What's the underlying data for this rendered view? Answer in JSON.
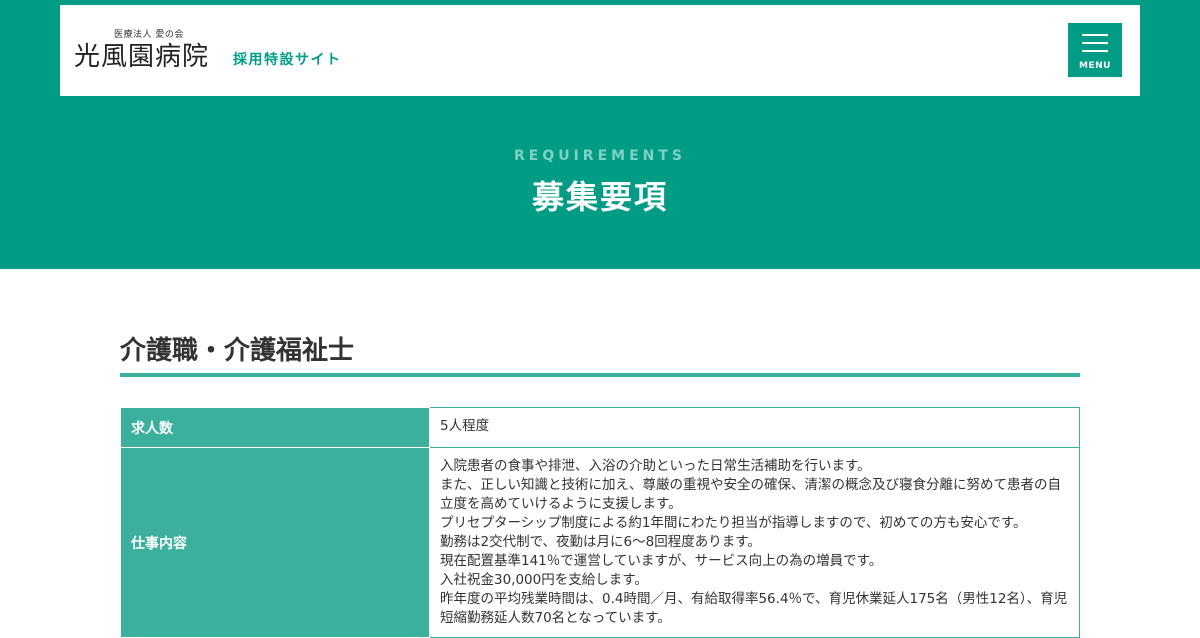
{
  "header": {
    "logo_sub": "医療法人 愛の会",
    "logo_main": "光風園病院",
    "logo_tag": "採用特設サイト",
    "menu_label": "MENU"
  },
  "hero": {
    "eyebrow": "REQUIREMENTS",
    "title": "募集要項"
  },
  "section": {
    "heading": "介護職・介護福祉士"
  },
  "table": {
    "rows": [
      {
        "label": "求人数",
        "lines": [
          "5人程度"
        ]
      },
      {
        "label": "仕事内容",
        "lines": [
          "入院患者の食事や排泄、入浴の介助といった日常生活補助を行います。",
          "また、正しい知識と技術に加え、尊厳の重視や安全の確保、清潔の概念及び寝食分離に努めて患者の自",
          "立度を高めていけるように支援します。",
          "プリセプターシップ制度による約1年間にわたり担当が指導しますので、初めての方も安心です。",
          "勤務は2交代制で、夜勤は月に6～8回程度あります。",
          "現在配置基準141％で運営していますが、サービス向上の為の増員です。",
          "入社祝金30,000円を支給します。",
          "昨年度の平均残業時間は、0.4時間／月、有給取得率56.4％で、育児休業延人175名（男性12名）、育児",
          "短縮勤務延人数70名となっています。"
        ]
      }
    ]
  },
  "colors": {
    "brand_green": "#009c84",
    "table_header": "#3bb19d",
    "eyebrow_text": "#7fd1c3"
  }
}
